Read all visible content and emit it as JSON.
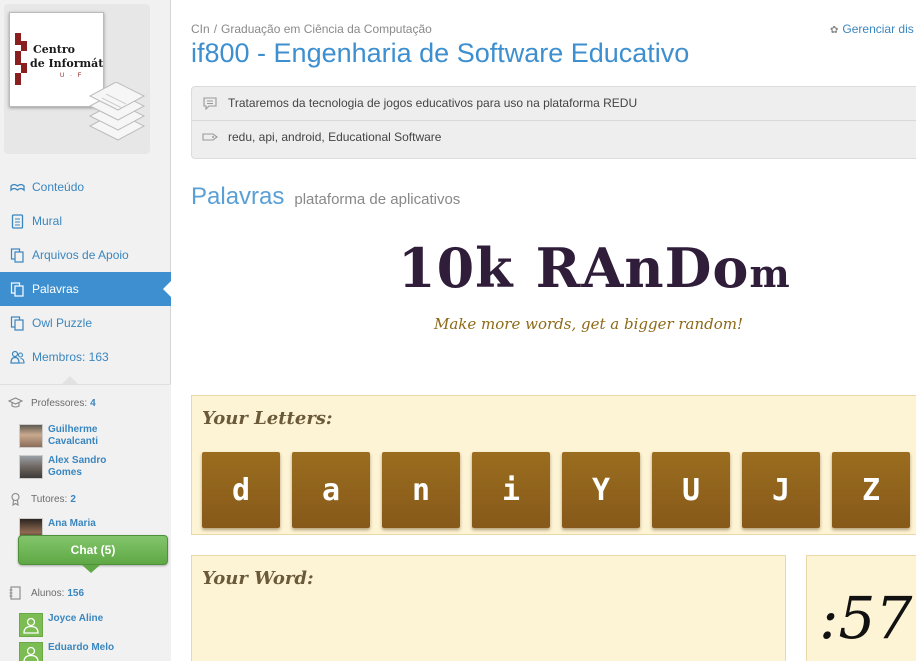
{
  "sidebar": {
    "logo": {
      "line1": "Centro",
      "line2": "de Informát",
      "line3": "U · F"
    },
    "nav": [
      {
        "label": "Conteúdo",
        "icon": "book-icon"
      },
      {
        "label": "Mural",
        "icon": "document-icon"
      },
      {
        "label": "Arquivos de Apoio",
        "icon": "files-icon"
      },
      {
        "label": "Palavras",
        "icon": "files-icon",
        "active": true
      },
      {
        "label": "Owl Puzzle",
        "icon": "files-icon"
      },
      {
        "label": "Membros: 163",
        "icon": "members-icon"
      }
    ],
    "members": {
      "professors_label": "Professores:",
      "professors_count": "4",
      "professors": [
        {
          "name": "Guilherme Cavalcanti"
        },
        {
          "name": "Alex Sandro Gomes"
        }
      ],
      "tutors_label": "Tutores:",
      "tutors_count": "2",
      "tutors": [
        {
          "name": "Ana Maria"
        }
      ],
      "students_label": "Alunos:",
      "students_count": "156",
      "students": [
        {
          "name": "Joyce Aline"
        },
        {
          "name": "Eduardo Melo"
        }
      ]
    },
    "chat_label": "Chat (5)"
  },
  "header": {
    "breadcrumb": [
      "CIn",
      "Graduação em Ciência da Computação"
    ],
    "manage_label": "Gerenciar dis",
    "course_title": "if800 - Engenharia de Software Educativo",
    "description": "Trataremos da tecnologia de jogos educativos para uso na plataforma REDU",
    "tags": "redu, api, android, Educational Software"
  },
  "section": {
    "title": "Palavras",
    "subtitle": "plataforma de aplicativos"
  },
  "game": {
    "title_part1": "10k",
    "title_part2": "RAnDo",
    "title_part3": "m",
    "tagline": "Make more words, get a bigger random!",
    "letters_label": "Your Letters:",
    "letters": [
      "d",
      "a",
      "n",
      "i",
      "Y",
      "U",
      "J",
      "Z"
    ],
    "word_label": "Your Word:",
    "timer": ":57"
  },
  "colors": {
    "accent": "#3d8fcf",
    "tile": "#8e6120",
    "panel": "#fdf3d5",
    "chat": "#6cb552"
  }
}
